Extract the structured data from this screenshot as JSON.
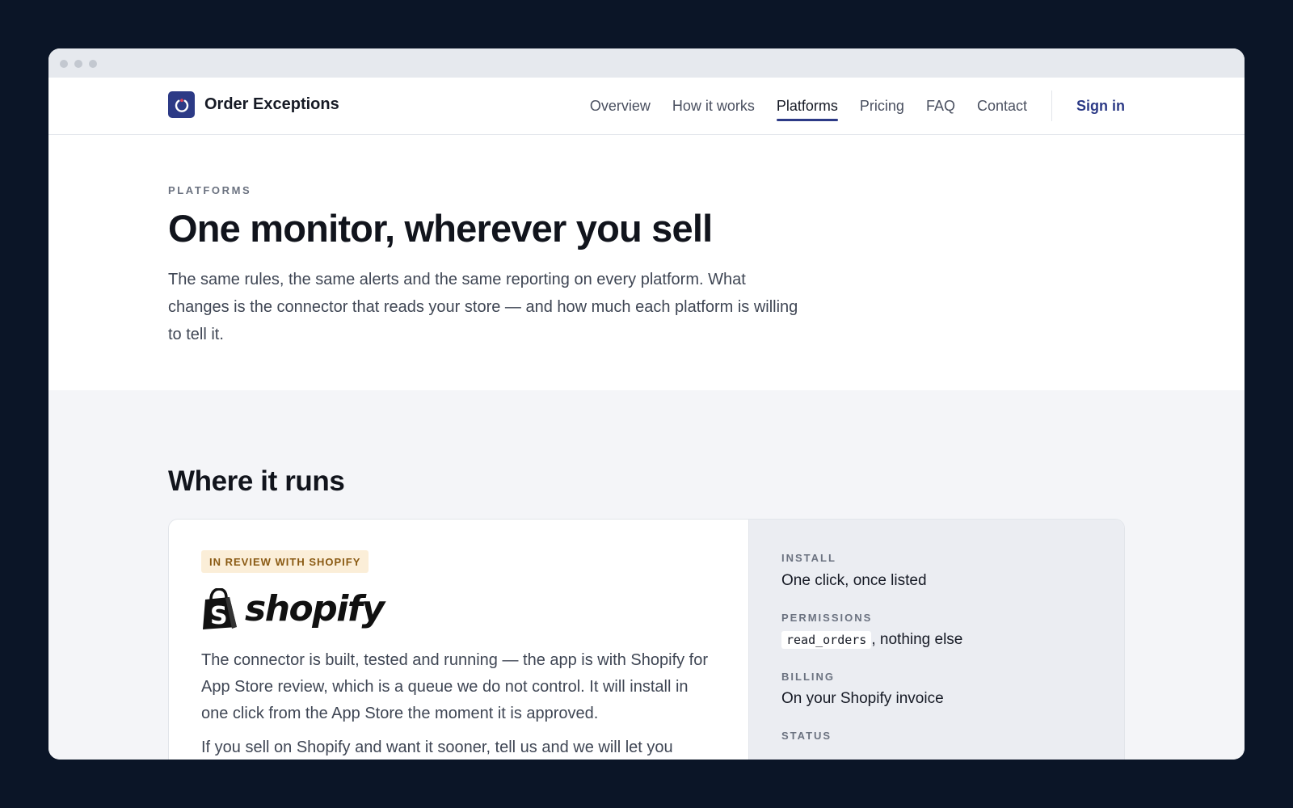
{
  "window": {
    "nav": {
      "brand": "Order Exceptions",
      "links": [
        "Overview",
        "How it works",
        "Platforms",
        "Pricing",
        "FAQ",
        "Contact"
      ],
      "active_link": "Platforms",
      "sign_in": "Sign in"
    },
    "hero": {
      "eyebrow": "PLATFORMS",
      "title": "One monitor, wherever you sell",
      "description": "The same rules, the same alerts and the same reporting on every platform. What changes is the connector that reads your store — and how much each platform is willing to tell it."
    },
    "section": {
      "title": "Where it runs",
      "card": {
        "badge": "IN REVIEW WITH SHOPIFY",
        "logo_word": "shopify",
        "body": "The connector is built, tested and running — the app is with Shopify for App Store review, which is a queue we do not control. It will install in one click from the App Store the moment it is approved.",
        "body2": "If you sell on Shopify and want it sooner, tell us and we will let you",
        "meta": {
          "install_label": "INSTALL",
          "install_value": "One click, once listed",
          "permissions_label": "PERMISSIONS",
          "permissions_code": "read_orders",
          "permissions_rest": ", nothing else",
          "billing_label": "BILLING",
          "billing_value": "On your Shopify invoice",
          "status_label": "STATUS"
        }
      }
    }
  },
  "colors": {
    "accent": "#2c3a86",
    "page_background": "#0b1527",
    "badge_bg": "#fbeed8",
    "badge_text": "#8a5a13"
  }
}
